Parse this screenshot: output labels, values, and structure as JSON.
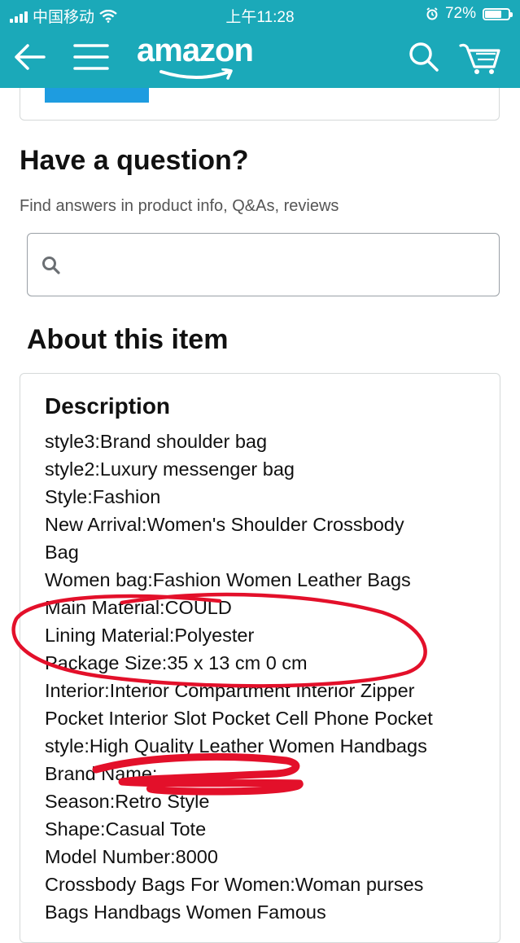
{
  "status_bar": {
    "carrier": "中国移动",
    "time": "上午11:28",
    "battery": "72%",
    "battery_level": 0.72
  },
  "nav": {
    "logo": "amazon",
    "icons": [
      "back-arrow-icon",
      "hamburger-menu-icon",
      "search-icon",
      "cart-icon"
    ]
  },
  "question": {
    "title": "Have a question?",
    "subtitle": "Find answers in product info, Q&As, reviews",
    "search_placeholder": ""
  },
  "about": {
    "title": "About this item",
    "description_heading": "Description",
    "lines": [
      "style3:Brand shoulder bag",
      "style2:Luxury messenger bag",
      "Style:Fashion",
      "New Arrival:Women's Shoulder Crossbody",
      "Bag",
      "Women bag:Fashion Women Leather Bags",
      "Main Material:COULD",
      "Lining Material:Polyester",
      "Package Size:35 x 13 cm 0 cm",
      "Interior:Interior Compartment Interior Zipper",
      "Pocket Interior Slot Pocket Cell Phone Pocket",
      "style:High Quality Leather Women Handbags",
      "Brand Name:",
      "Season:Retro Style",
      "Shape:Casual Tote",
      "Model Number:8000",
      "Crossbody Bags For Women:Woman purses",
      "Bags Handbags Women Famous"
    ]
  },
  "colors": {
    "header": "#1ba9b9",
    "annotation": "#e3102a",
    "button_blue": "#1e9ce0"
  }
}
